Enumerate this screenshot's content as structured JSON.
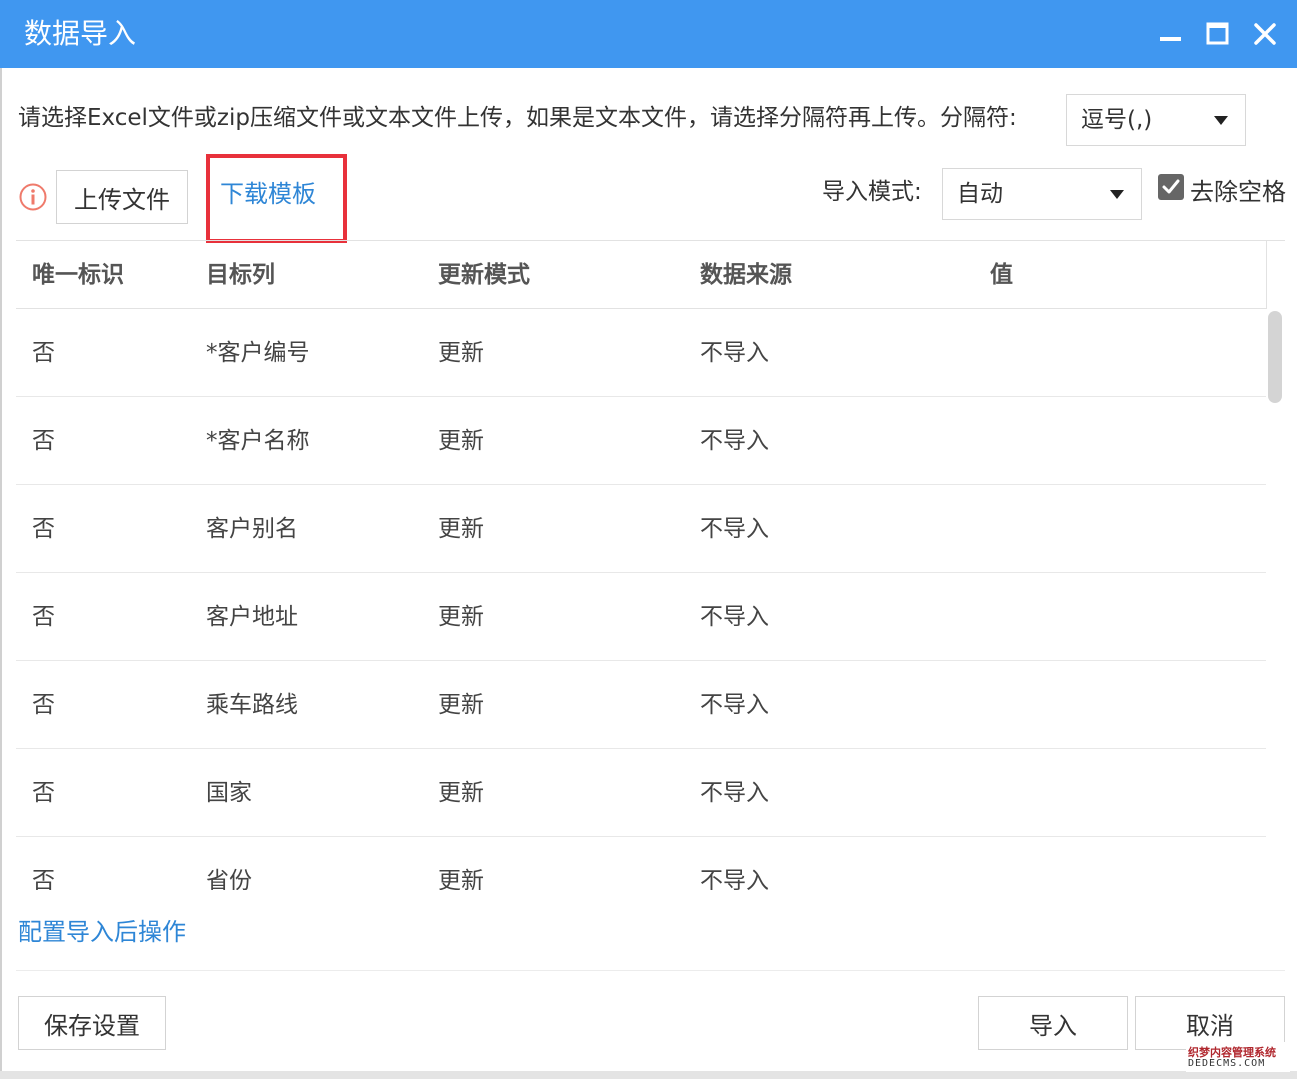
{
  "window": {
    "title": "数据导入",
    "title_bar_color": "#4097f0",
    "controls": [
      "minimize-icon",
      "maximize-icon",
      "close-icon"
    ]
  },
  "toolbar": {
    "instruction": "请选择Excel文件或zip压缩文件或文本文件上传，如果是文本文件，请选择分隔符再上传。分隔符:",
    "separator_value": "逗号(,)",
    "upload_label": "上传文件",
    "download_template_label": "下载模板",
    "import_mode_label": "导入模式:",
    "import_mode_value": "自动",
    "trim_spaces_label": "去除空格",
    "trim_spaces_checked": true,
    "info_icon": "info-icon"
  },
  "table": {
    "headers": [
      "唯一标识",
      "目标列",
      "更新模式",
      "数据来源",
      "值"
    ],
    "rows": [
      [
        "否",
        "*客户编号",
        "更新",
        "不导入",
        ""
      ],
      [
        "否",
        "*客户名称",
        "更新",
        "不导入",
        ""
      ],
      [
        "否",
        "客户别名",
        "更新",
        "不导入",
        ""
      ],
      [
        "否",
        "客户地址",
        "更新",
        "不导入",
        ""
      ],
      [
        "否",
        "乘车路线",
        "更新",
        "不导入",
        ""
      ],
      [
        "否",
        "国家",
        "更新",
        "不导入",
        ""
      ],
      [
        "否",
        "省份",
        "更新",
        "不导入",
        ""
      ]
    ]
  },
  "footer": {
    "config_link": "配置导入后操作",
    "save_label": "保存设置",
    "import_label": "导入",
    "cancel_label": "取消"
  },
  "watermark": {
    "line1": "织梦内容管理系统",
    "line2": "DEDECMS.COM"
  },
  "colors": {
    "accent": "#4097f0",
    "link": "#2e86d6",
    "highlight": "#e8313b"
  }
}
